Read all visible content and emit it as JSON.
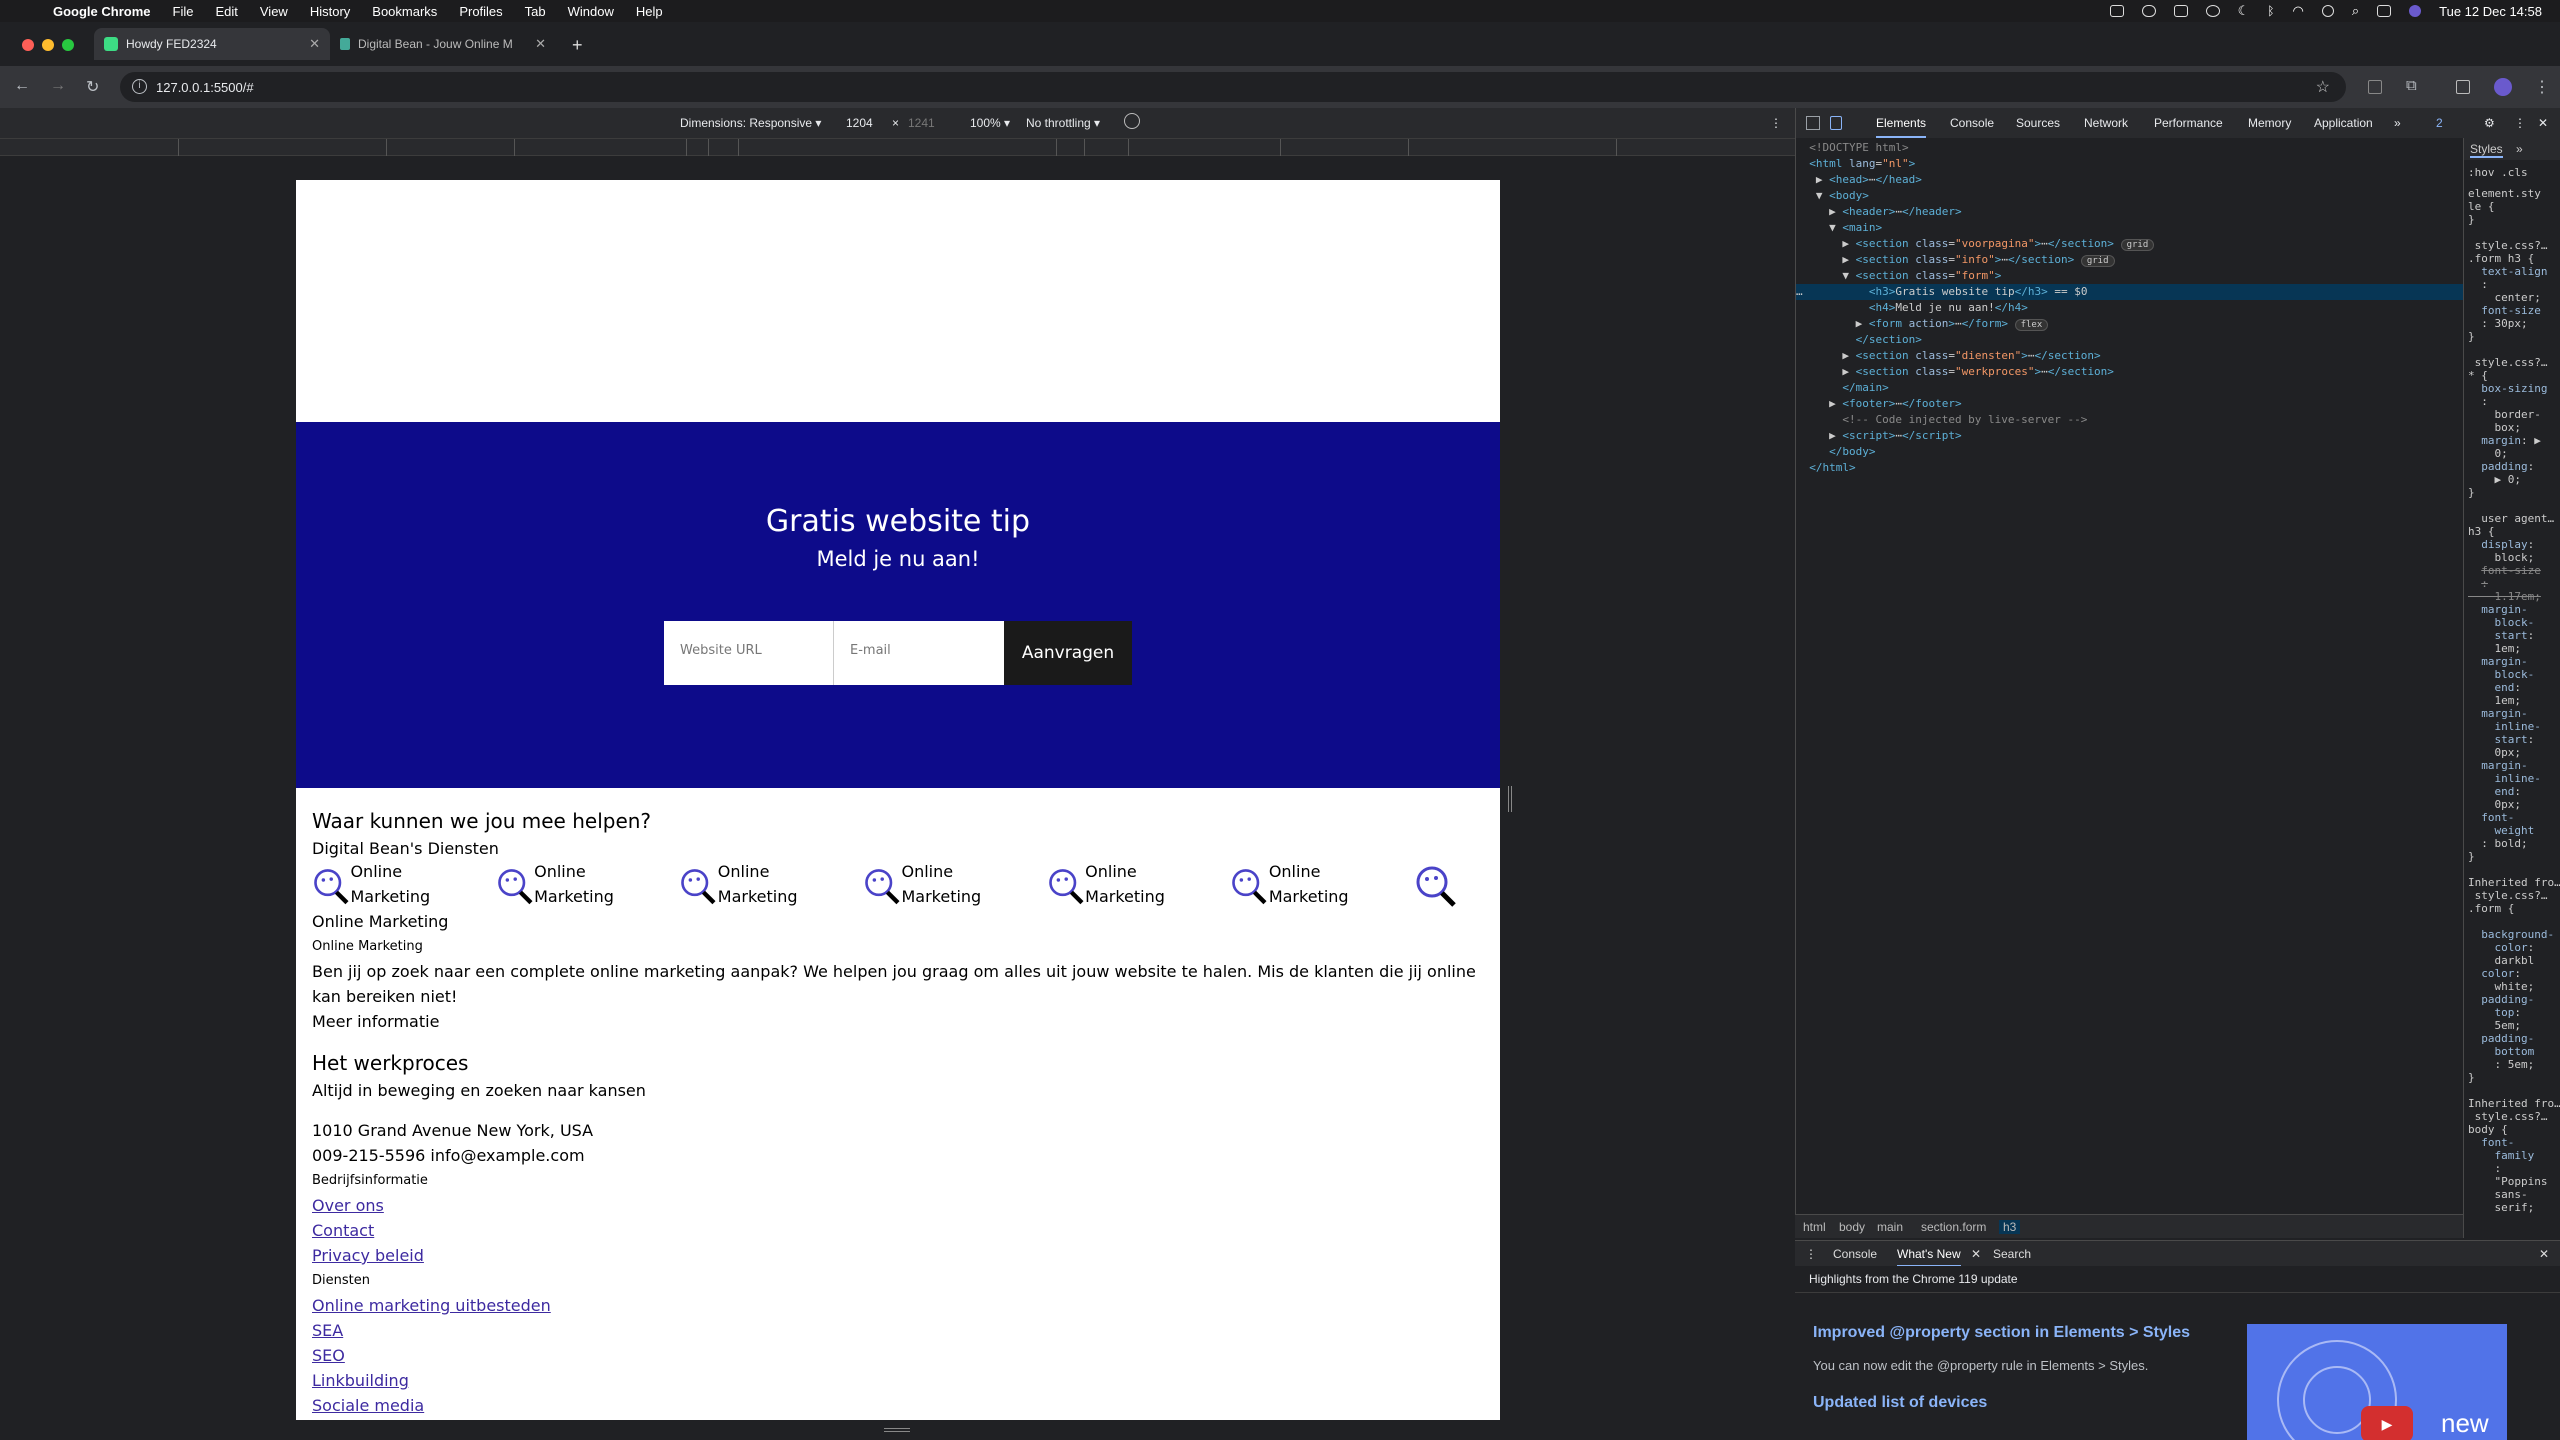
{
  "menubar": {
    "app": "Google Chrome",
    "items": [
      "File",
      "Edit",
      "View",
      "History",
      "Bookmarks",
      "Profiles",
      "Tab",
      "Window",
      "Help"
    ],
    "clock": "Tue 12 Dec  14:58"
  },
  "tabs": [
    {
      "title": "Howdy FED2324",
      "active": true
    },
    {
      "title": "Digital Bean - Jouw Online M",
      "active": false
    }
  ],
  "address": {
    "url": "127.0.0.1:5500/#"
  },
  "device_toolbar": {
    "dimensions_label": "Dimensions: Responsive ▾",
    "width": "1204",
    "times": "×",
    "height": "1241",
    "zoom": "100% ▾",
    "throttle": "No throttling ▾"
  },
  "page": {
    "form": {
      "title": "Gratis website tip",
      "subtitle": "Meld je nu aan!",
      "url_placeholder": "Website URL",
      "email_placeholder": "E-mail",
      "submit": "Aanvragen"
    },
    "help_title": "Waar kunnen we jou mee helpen?",
    "services_sub": "Digital Bean's Diensten",
    "service_label": "Online Marketing",
    "service_heading": "Online Marketing",
    "service_small": "Online Marketing",
    "service_text": "Ben jij op zoek naar een complete online marketing aanpak? We helpen jou graag om alles uit jouw website te halen. Mis de klanten die jij online kan bereiken niet!",
    "more_info": "Meer informatie",
    "process_title": "Het werkproces",
    "process_sub": "Altijd in beweging en zoeken naar kansen",
    "address": "1010 Grand Avenue New York, USA",
    "contact": "009-215-5596 info@example.com",
    "company_heading": "Bedrijfsinformatie",
    "company_links": [
      "Over ons",
      "Contact",
      "Privacy beleid"
    ],
    "services_heading": "Diensten",
    "service_links": [
      "Online marketing uitbesteden",
      "SEA",
      "SEO",
      "Linkbuilding",
      "Sociale media"
    ]
  },
  "devtools": {
    "tabs": [
      "Elements",
      "Console",
      "Sources",
      "Network",
      "Performance",
      "Memory",
      "Application"
    ],
    "issues": "2",
    "breadcrumb": [
      "html",
      "body",
      "main",
      "section.form",
      "h3"
    ],
    "drawer_tabs": [
      "Console",
      "What's New",
      "Search"
    ],
    "drawer_highlight": "Highlights from the Chrome 119 update",
    "drawer_h1": "Improved @property section in Elements > Styles",
    "drawer_p1": "You can now edit the @property rule in Elements > Styles.",
    "drawer_h2": "Updated list of devices",
    "drawer_video_label": "new",
    "styles_header": "Styles",
    "filter": ":hov  .cls"
  },
  "colors": {
    "form_bg": "#0d0b8a",
    "link": "#3d2aa0"
  }
}
